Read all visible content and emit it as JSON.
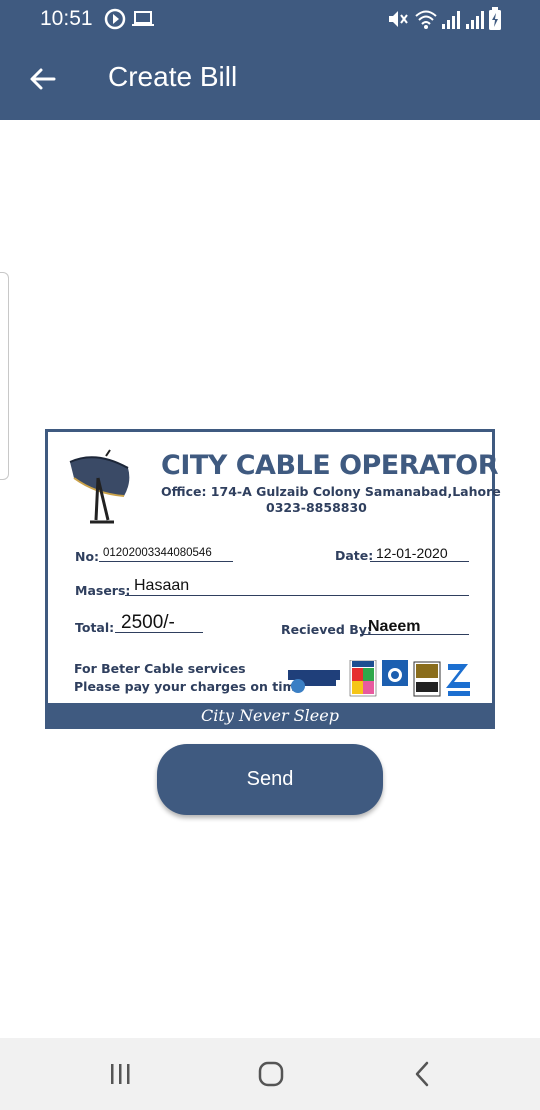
{
  "status": {
    "time": "10:51",
    "icons": [
      "b-circle-icon",
      "laptop-icon",
      "mute-icon",
      "wifi-icon",
      "signal-icon",
      "signal-icon",
      "battery-icon"
    ]
  },
  "app_bar": {
    "title": "Create Bill",
    "back_icon": "arrow-left-icon"
  },
  "bill": {
    "company": "CITY CABLE OPERATOR",
    "office": "Office: 174-A Gulzaib Colony Samanabad,Lahore",
    "phone": "0323-8858830",
    "no_label": "No:",
    "no_value": "01202003344080546",
    "date_label": "Date:",
    "date_value": "12-01-2020",
    "masers_label": "Masers:",
    "masers_value": "Hasaan",
    "total_label": "Total:",
    "total_value": "2500/-",
    "received_label": "Recieved By:",
    "received_value": "Naeem",
    "footer_line1": "For Beter Cable services",
    "footer_line2": "Please pay your charges on time",
    "tagline": "City Never Sleep",
    "logos": [
      "discovery-logo",
      "hum-logo",
      "geo-news-logo",
      "ary-digital-logo",
      "zee-tv-logo"
    ]
  },
  "send_label": "Send",
  "colors": {
    "primary": "#3f5a80",
    "text_dark": "#2f3f5e"
  }
}
